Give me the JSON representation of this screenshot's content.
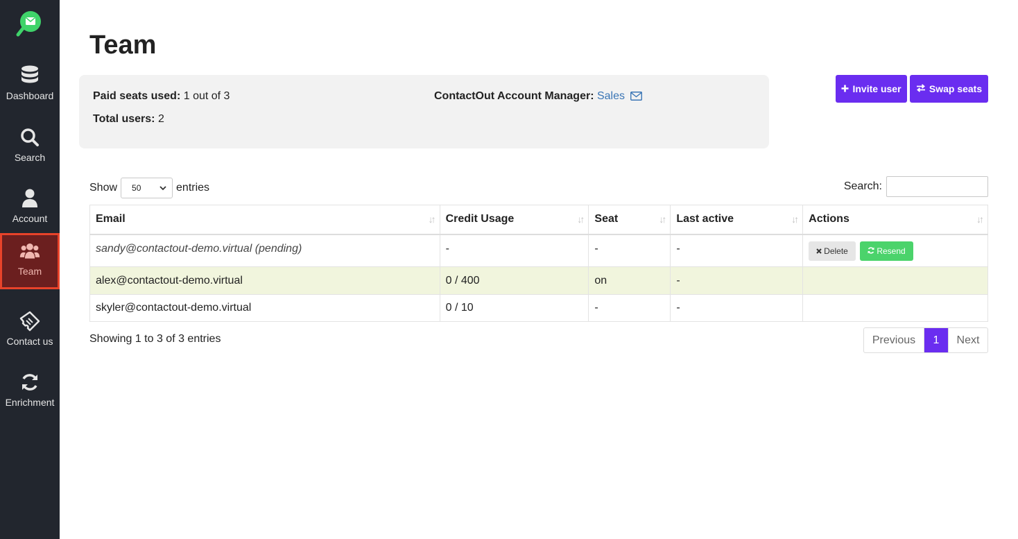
{
  "sidebar": {
    "items": [
      {
        "label": "Dashboard"
      },
      {
        "label": "Search"
      },
      {
        "label": "Account"
      },
      {
        "label": "Team"
      },
      {
        "label": "Contact us"
      },
      {
        "label": "Enrichment"
      }
    ],
    "active": "Team"
  },
  "page": {
    "title": "Team"
  },
  "info": {
    "paid_seats_label": "Paid seats used:",
    "paid_seats_value": " 1 out of 3",
    "total_users_label": "Total users:",
    "total_users_value": " 2",
    "manager_label": "ContactOut Account Manager:",
    "manager_link": "Sales"
  },
  "actions": {
    "invite": "Invite user",
    "swap": "Swap seats"
  },
  "table_controls": {
    "show": "Show",
    "entries_value": "50",
    "entries": "entries",
    "search_label": "Search:"
  },
  "table": {
    "columns": [
      "Email",
      "Credit Usage",
      "Seat",
      "Last active",
      "Actions"
    ],
    "rows": [
      {
        "email": "sandy@contactout-demo.virtual (pending)",
        "credit": "-",
        "seat": "-",
        "last_active": "-"
      },
      {
        "email": "alex@contactout-demo.virtual",
        "credit": "0 / 400",
        "seat": "on",
        "last_active": "-"
      },
      {
        "email": "skyler@contactout-demo.virtual",
        "credit": "0 / 10",
        "seat": "-",
        "last_active": "-"
      }
    ],
    "row_actions": {
      "delete": "Delete",
      "resend": "Resend"
    }
  },
  "footer": {
    "showing": "Showing 1 to 3 of 3 entries",
    "previous": "Previous",
    "current_page": "1",
    "next": "Next"
  },
  "colors": {
    "sidebar": "#22262e",
    "accent": "#6a2df0",
    "active_nav": "#6b1f1f",
    "active_border": "#e8432a",
    "resend": "#4bd36b",
    "highlight_row": "#f1f5dd"
  }
}
